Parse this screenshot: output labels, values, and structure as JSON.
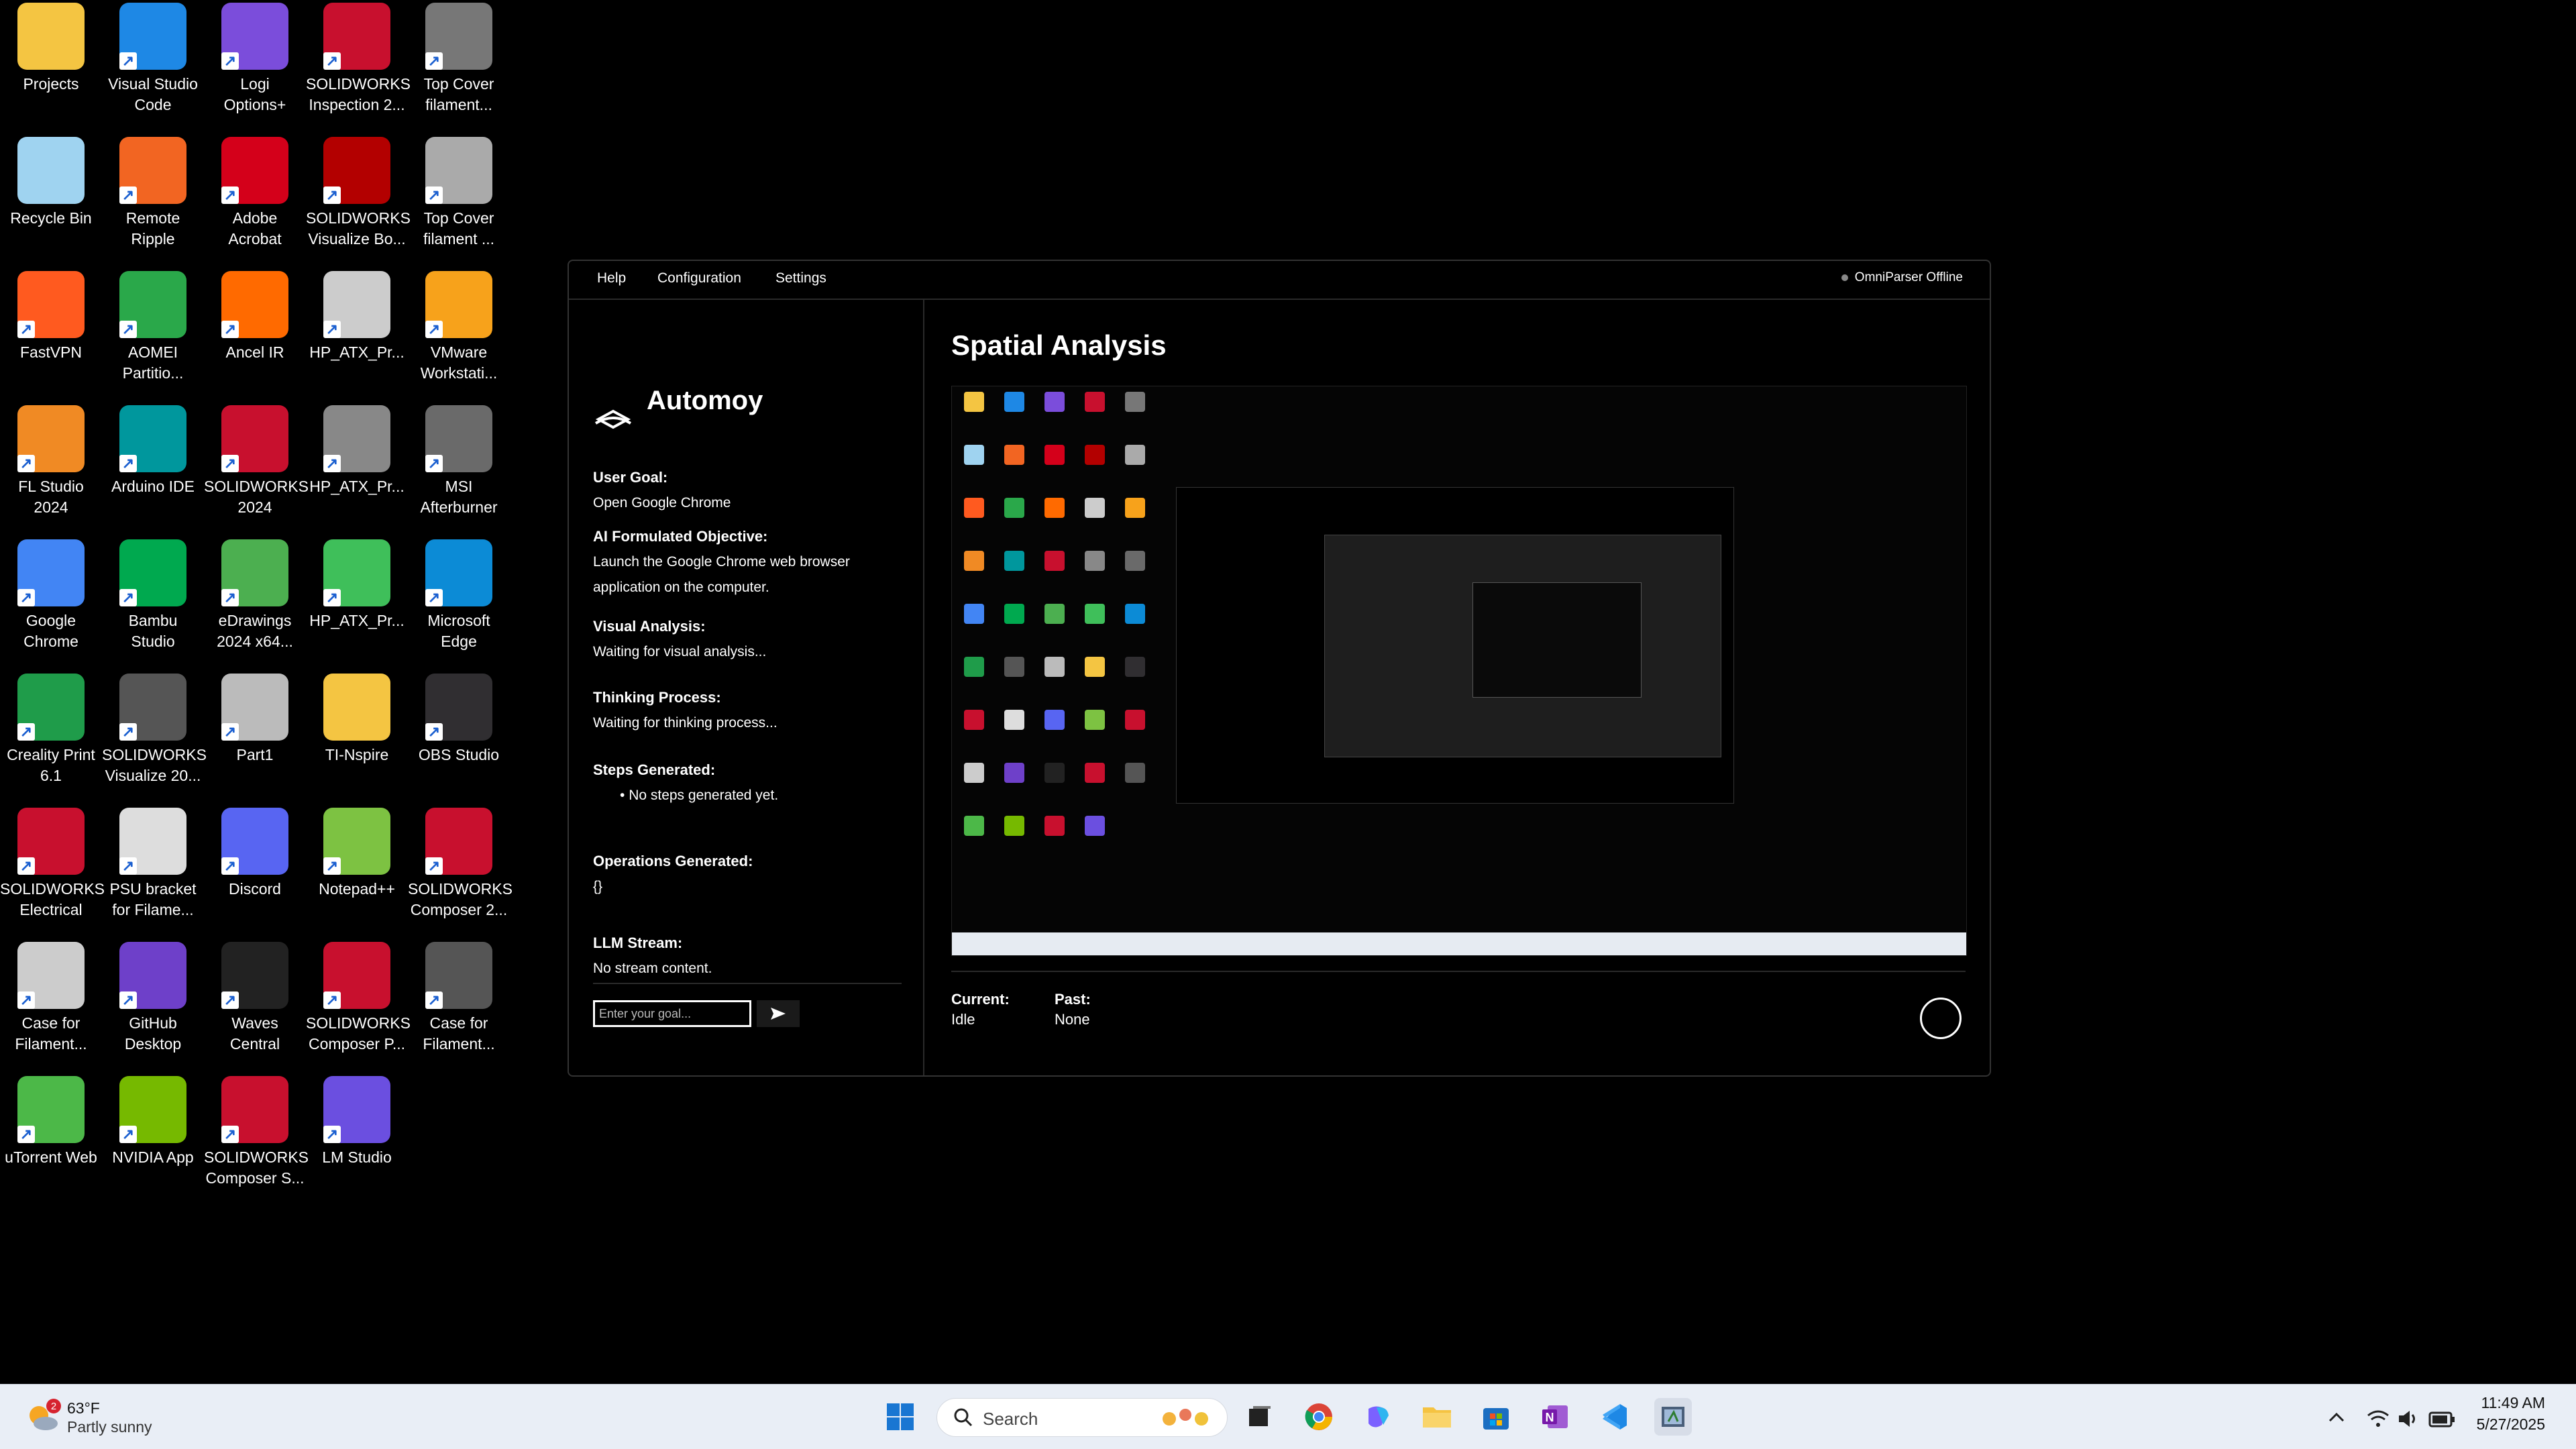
{
  "desktop": {
    "icons": [
      {
        "label": "Projects",
        "icon": "folder-icon",
        "color": "#f4c542"
      },
      {
        "label": "Visual Studio\nCode",
        "icon": "vscode-icon",
        "color": "#1e88e5"
      },
      {
        "label": "Logi\nOptions+",
        "icon": "logi-options-icon",
        "color": "#7b4ddb"
      },
      {
        "label": "SOLIDWORKS\nInspection 2...",
        "icon": "solidworks-icon",
        "color": "#c8102e"
      },
      {
        "label": "Top Cover\nfilament...",
        "icon": "part-file-icon",
        "color": "#777777"
      },
      {
        "label": "Recycle Bin",
        "icon": "recycle-bin-icon",
        "color": "#9fd3f0"
      },
      {
        "label": "Remote\nRipple",
        "icon": "remote-ripple-icon",
        "color": "#f26522"
      },
      {
        "label": "Adobe\nAcrobat",
        "icon": "acrobat-icon",
        "color": "#d4001a"
      },
      {
        "label": "SOLIDWORKS\nVisualize Bo...",
        "icon": "solidworks-visualize-icon",
        "color": "#b30000"
      },
      {
        "label": "Top Cover\nfilament ...",
        "icon": "drawing-file-icon",
        "color": "#aaaaaa"
      },
      {
        "label": "FastVPN",
        "icon": "fastvpn-icon",
        "color": "#ff5a1f"
      },
      {
        "label": "AOMEI\nPartitio...",
        "icon": "aomei-icon",
        "color": "#2aa84a"
      },
      {
        "label": "Ancel IR",
        "icon": "ancel-icon",
        "color": "#ff6a00"
      },
      {
        "label": "HP_ATX_Pr...",
        "icon": "drawing-file-icon",
        "color": "#cccccc"
      },
      {
        "label": "VMware\nWorkstati...",
        "icon": "vmware-icon",
        "color": "#f7a21b"
      },
      {
        "label": "FL Studio\n2024",
        "icon": "fl-studio-icon",
        "color": "#f08a24"
      },
      {
        "label": "Arduino IDE",
        "icon": "arduino-icon",
        "color": "#00979d"
      },
      {
        "label": "SOLIDWORKS\n2024",
        "icon": "solidworks-icon",
        "color": "#c8102e"
      },
      {
        "label": "HP_ATX_Pr...",
        "icon": "part-file-icon",
        "color": "#888888"
      },
      {
        "label": "MSI\nAfterburner",
        "icon": "msi-afterburner-icon",
        "color": "#6a6a6a"
      },
      {
        "label": "Google\nChrome",
        "icon": "chrome-icon",
        "color": "#4285f4"
      },
      {
        "label": "Bambu\nStudio",
        "icon": "bambu-icon",
        "color": "#00a94f"
      },
      {
        "label": "eDrawings\n2024 x64...",
        "icon": "edrawings-icon",
        "color": "#4caf50"
      },
      {
        "label": "HP_ATX_Pr...",
        "icon": "part-file-icon",
        "color": "#3fbf5a"
      },
      {
        "label": "Microsoft\nEdge",
        "icon": "edge-icon",
        "color": "#0c8bd6"
      },
      {
        "label": "Creality Print\n6.1",
        "icon": "creality-icon",
        "color": "#1f9c4a"
      },
      {
        "label": "SOLIDWORKS\nVisualize 20...",
        "icon": "solidworks-visualize-icon",
        "color": "#555555"
      },
      {
        "label": "Part1",
        "icon": "part-file-icon",
        "color": "#bbbbbb"
      },
      {
        "label": "TI-Nspire",
        "icon": "folder-icon",
        "color": "#f4c542"
      },
      {
        "label": "OBS Studio",
        "icon": "obs-icon",
        "color": "#302e31"
      },
      {
        "label": "SOLIDWORKS\nElectrical",
        "icon": "solidworks-electrical-icon",
        "color": "#c8102e"
      },
      {
        "label": "PSU bracket\nfor Filame...",
        "icon": "drawing-file-icon",
        "color": "#dddddd"
      },
      {
        "label": "Discord",
        "icon": "discord-icon",
        "color": "#5865f2"
      },
      {
        "label": "Notepad++",
        "icon": "notepad-plus-icon",
        "color": "#7dc242"
      },
      {
        "label": "SOLIDWORKS\nComposer 2...",
        "icon": "solidworks-composer-icon",
        "color": "#c8102e"
      },
      {
        "label": "Case for\nFilament...",
        "icon": "drawing-file-icon",
        "color": "#cccccc"
      },
      {
        "label": "GitHub\nDesktop",
        "icon": "github-icon",
        "color": "#6e40c9"
      },
      {
        "label": "Waves\nCentral",
        "icon": "waves-icon",
        "color": "#222222"
      },
      {
        "label": "SOLIDWORKS\nComposer P...",
        "icon": "solidworks-composer-icon",
        "color": "#c8102e"
      },
      {
        "label": "Case for\nFilament...",
        "icon": "part-file-icon",
        "color": "#555555"
      },
      {
        "label": "uTorrent Web",
        "icon": "utorrent-icon",
        "color": "#4cb848"
      },
      {
        "label": "NVIDIA App",
        "icon": "nvidia-icon",
        "color": "#76b900"
      },
      {
        "label": "SOLIDWORKS\nComposer S...",
        "icon": "solidworks-composer-icon",
        "color": "#c8102e"
      },
      {
        "label": "LM Studio",
        "icon": "lm-studio-icon",
        "color": "#6b4fe0"
      }
    ]
  },
  "app": {
    "menu": {
      "help": "Help",
      "configuration": "Configuration",
      "settings": "Settings"
    },
    "status": "OmniParser Offline",
    "brand": "Automoy",
    "sections": {
      "user_goal_title": "User Goal:",
      "user_goal_value": "Open Google Chrome",
      "objective_title": "AI Formulated Objective:",
      "objective_value": "Launch the Google Chrome web browser application on the computer.",
      "visual_title": "Visual Analysis:",
      "visual_value": "Waiting for visual analysis...",
      "thinking_title": "Thinking Process:",
      "thinking_value": "Waiting for thinking process...",
      "steps_title": "Steps Generated:",
      "steps_value": "No steps generated yet.",
      "operations_title": "Operations Generated:",
      "operations_value": "{}",
      "llm_title": "LLM Stream:",
      "llm_value": "No stream content."
    },
    "goal_input_placeholder": "Enter your goal...",
    "spatial_title": "Spatial Analysis",
    "state": {
      "current_label": "Current:",
      "current_value": "Idle",
      "past_label": "Past:",
      "past_value": "None"
    }
  },
  "taskbar": {
    "weather": {
      "badge": "2",
      "temp": "63°F",
      "desc": "Partly sunny"
    },
    "search_label": "Search",
    "apps": [
      "start-icon",
      "task-view-icon",
      "chrome-icon",
      "copilot-icon",
      "file-explorer-icon",
      "store-icon",
      "onenote-icon",
      "vscode-icon",
      "python-app-icon"
    ],
    "clock": {
      "time": "11:49 AM",
      "date": "5/27/2025"
    }
  }
}
